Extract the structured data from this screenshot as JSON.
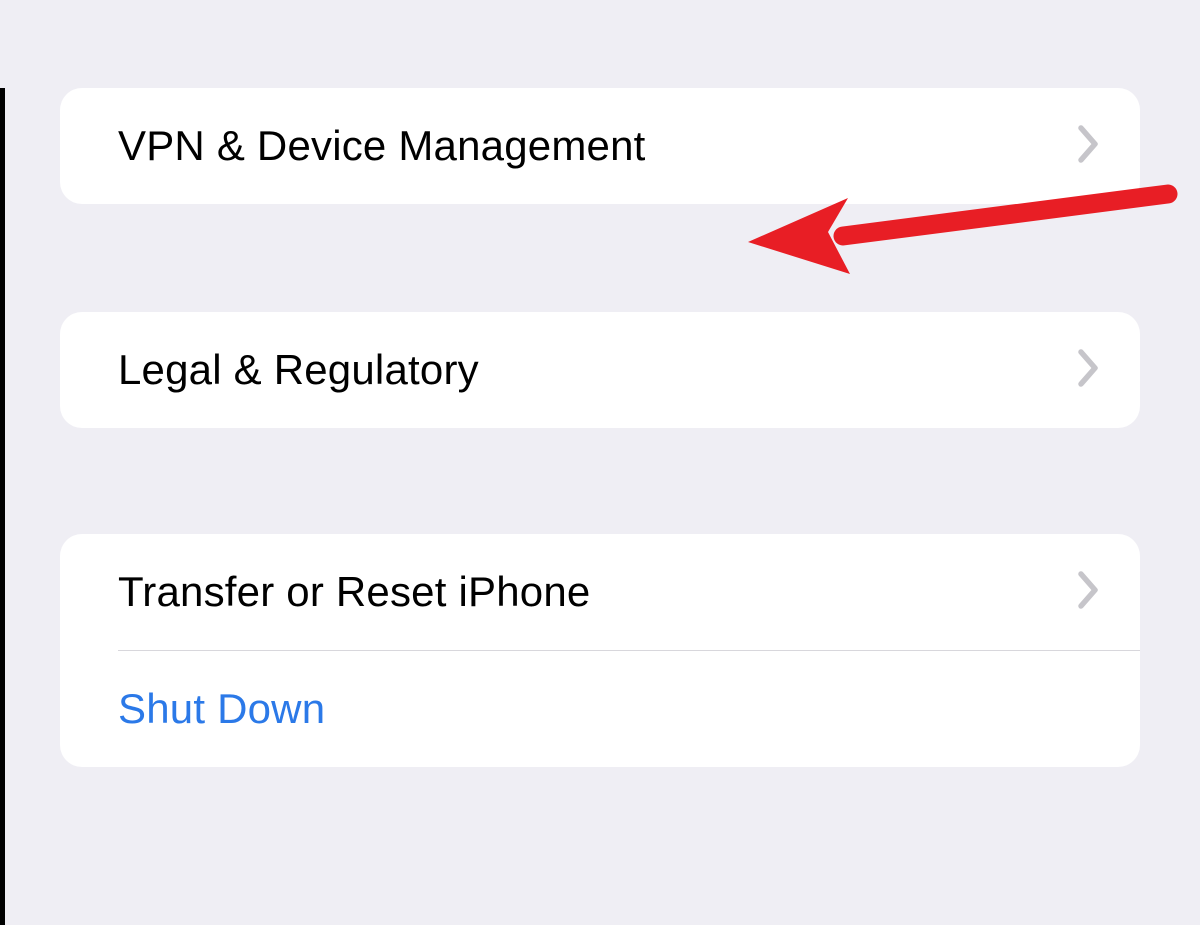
{
  "sections": [
    {
      "rows": [
        {
          "label": "VPN & Device Management",
          "has_chevron": true,
          "is_link": false
        }
      ]
    },
    {
      "rows": [
        {
          "label": "Legal & Regulatory",
          "has_chevron": true,
          "is_link": false
        }
      ]
    },
    {
      "rows": [
        {
          "label": "Transfer or Reset iPhone",
          "has_chevron": true,
          "is_link": false
        },
        {
          "label": "Shut Down",
          "has_chevron": false,
          "is_link": true
        }
      ]
    }
  ],
  "annotation": {
    "type": "arrow",
    "color": "#e81e25"
  }
}
